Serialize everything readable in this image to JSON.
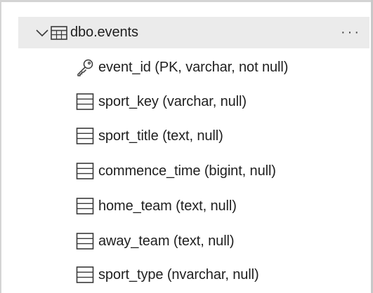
{
  "table": {
    "label": "dbo.events",
    "more_label": "···"
  },
  "columns": [
    {
      "label": "event_id (PK, varchar, not null)",
      "icon": "key-icon"
    },
    {
      "label": "sport_key (varchar, null)",
      "icon": "column-icon"
    },
    {
      "label": "sport_title (text, null)",
      "icon": "column-icon"
    },
    {
      "label": "commence_time (bigint, null)",
      "icon": "column-icon"
    },
    {
      "label": "home_team (text, null)",
      "icon": "column-icon"
    },
    {
      "label": "away_team (text, null)",
      "icon": "column-icon"
    },
    {
      "label": "sport_type (nvarchar, null)",
      "icon": "column-icon"
    }
  ],
  "colors": {
    "selected_row_bg": "#ebebeb",
    "icon_stroke": "#3a3a3a"
  }
}
